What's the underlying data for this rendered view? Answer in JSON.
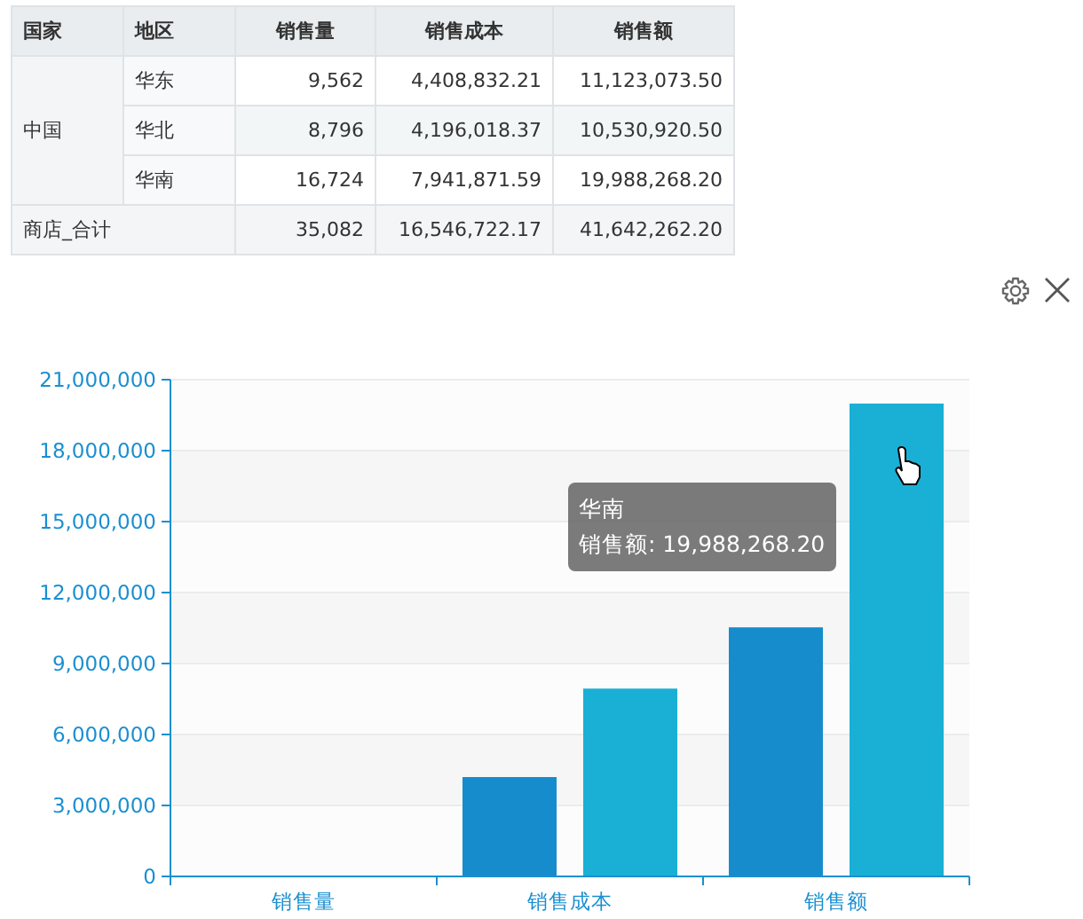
{
  "table": {
    "columns": [
      "国家",
      "地区",
      "销售量",
      "销售成本",
      "销售额"
    ],
    "groups": [
      {
        "country": "中国",
        "rows": [
          {
            "region": "华东",
            "values": [
              "9,562",
              "4,408,832.21",
              "11,123,073.50"
            ]
          },
          {
            "region": "华北",
            "values": [
              "8,796",
              "4,196,018.37",
              "10,530,920.50"
            ]
          },
          {
            "region": "华南",
            "values": [
              "16,724",
              "7,941,871.59",
              "19,988,268.20"
            ]
          }
        ]
      }
    ],
    "total": {
      "label": "商店_合计",
      "values": [
        "35,082",
        "16,546,722.17",
        "41,642,262.20"
      ]
    }
  },
  "chart": {
    "chart_data": {
      "type": "bar",
      "categories": [
        "销售量",
        "销售成本",
        "销售额"
      ],
      "series": [
        {
          "color": "#168ccd",
          "values": [
            0,
            4200000,
            10530000
          ]
        },
        {
          "color": "#1ab0d6",
          "values": [
            0,
            7940000,
            19990000
          ]
        }
      ],
      "grid": true,
      "ylim": [
        0,
        21000000
      ],
      "yticks": [
        {
          "value": 0,
          "label": "0"
        },
        {
          "value": 3000000,
          "label": "3,000,000"
        },
        {
          "value": 6000000,
          "label": "6,000,000"
        },
        {
          "value": 9000000,
          "label": "9,000,000"
        },
        {
          "value": 12000000,
          "label": "12,000,000"
        },
        {
          "value": 15000000,
          "label": "15,000,000"
        },
        {
          "value": 18000000,
          "label": "18,000,000"
        },
        {
          "value": 21000000,
          "label": "21,000,000"
        }
      ]
    },
    "tooltip": {
      "title": "华南",
      "label": "销售额: 19,988,268.20"
    }
  }
}
